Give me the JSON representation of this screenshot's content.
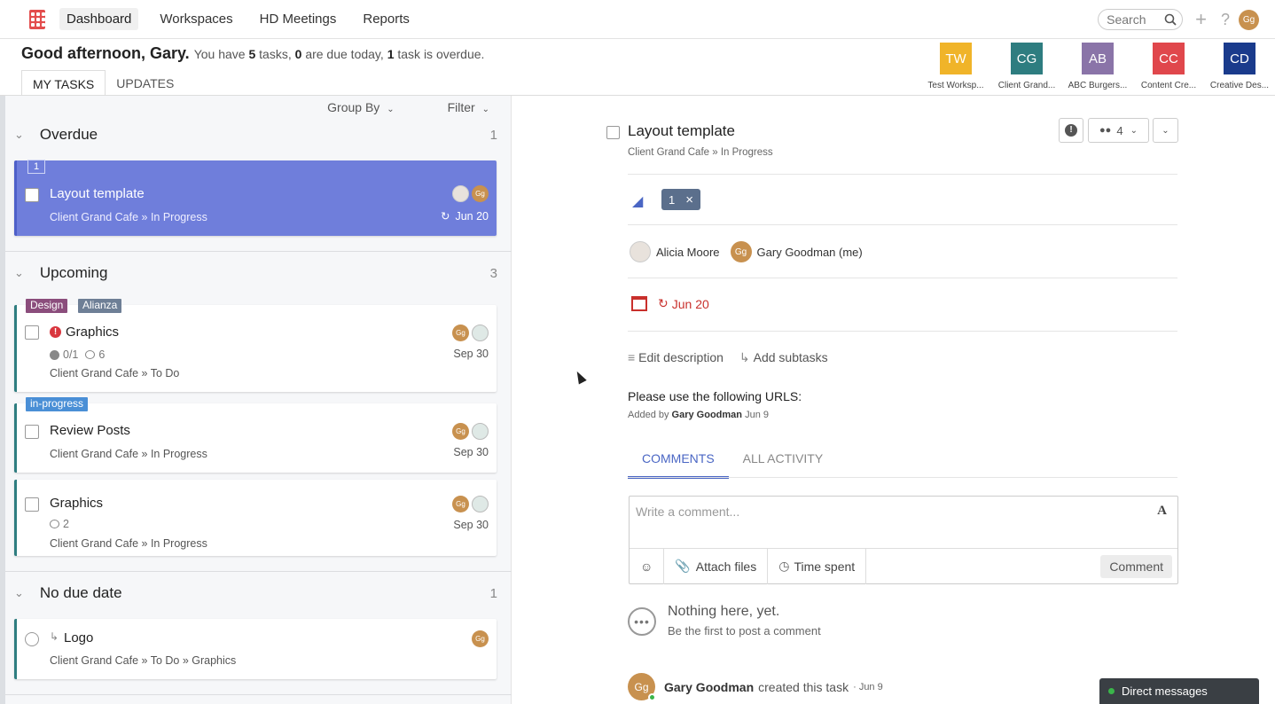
{
  "nav": {
    "links": [
      "Dashboard",
      "Workspaces",
      "HD Meetings",
      "Reports"
    ],
    "search_placeholder": "Search",
    "user_initials": "Gg"
  },
  "greeting": {
    "hello": "Good afternoon, Gary.",
    "summary_prefix": "You have",
    "tasks_count": "5",
    "summary_mid1": "tasks,",
    "due_count": "0",
    "summary_mid2": "are due today,",
    "overdue_count": "1",
    "summary_end": "task is overdue."
  },
  "tabs": [
    "MY TASKS",
    "UPDATES"
  ],
  "workspaces": [
    {
      "initials": "TW",
      "name": "Test Worksp...",
      "color": "#f0b429"
    },
    {
      "initials": "CG",
      "name": "Client Grand...",
      "color": "#2e7d80"
    },
    {
      "initials": "AB",
      "name": "ABC Burgers...",
      "color": "#8a74a8"
    },
    {
      "initials": "CC",
      "name": "Content Cre...",
      "color": "#e0474c"
    },
    {
      "initials": "CD",
      "name": "Creative Des...",
      "color": "#1a3b8c"
    }
  ],
  "toolbar": {
    "group_by": "Group By",
    "filter": "Filter"
  },
  "sections": {
    "overdue": {
      "label": "Overdue",
      "count": "1"
    },
    "upcoming": {
      "label": "Upcoming",
      "count": "3"
    },
    "nodue": {
      "label": "No due date",
      "count": "1"
    }
  },
  "tasks": {
    "t1": {
      "badge": "1",
      "title": "Layout template",
      "path": "Client Grand Cafe » In Progress",
      "date": "Jun 20"
    },
    "t2": {
      "tags": [
        "Design",
        "Alianza"
      ],
      "title": "Graphics",
      "subtasks": "0/1",
      "comments": "6",
      "path": "Client Grand Cafe » To Do",
      "date": "Sep 30"
    },
    "t3": {
      "tags": [
        "in-progress"
      ],
      "title": "Review Posts",
      "path": "Client Grand Cafe » In Progress",
      "date": "Sep 30"
    },
    "t4": {
      "title": "Graphics",
      "comments": "2",
      "path": "Client Grand Cafe » In Progress",
      "date": "Sep 30"
    },
    "t5": {
      "title": "Logo",
      "path": "Client Grand Cafe » To Do » Graphics"
    }
  },
  "detail": {
    "title": "Layout template",
    "crumb_ws": "Client Grand Cafe",
    "crumb_status": "In Progress",
    "followers": "4",
    "tag": "1",
    "assignees": [
      "Alicia Moore",
      "Gary Goodman (me)"
    ],
    "due": "Jun 20",
    "edit_description": "Edit description",
    "add_subtasks": "Add subtasks",
    "description": "Please use the following URLS:",
    "added_by_prefix": "Added by",
    "added_by": "Gary Goodman",
    "added_date": "Jun 9",
    "comment_tabs": [
      "COMMENTS",
      "ALL ACTIVITY"
    ],
    "comment_placeholder": "Write a comment...",
    "attach": "Attach files",
    "time_spent": "Time spent",
    "comment_btn": "Comment",
    "empty_title": "Nothing here, yet.",
    "empty_sub": "Be the first to post a comment",
    "activity_user": "Gary Goodman",
    "activity_text": "created this task",
    "activity_date": "Jun 9"
  },
  "dm": "Direct messages",
  "colors": {
    "accent": "#4a66c4",
    "selected_card": "#6f7edb",
    "overdue": "#c9302c"
  }
}
